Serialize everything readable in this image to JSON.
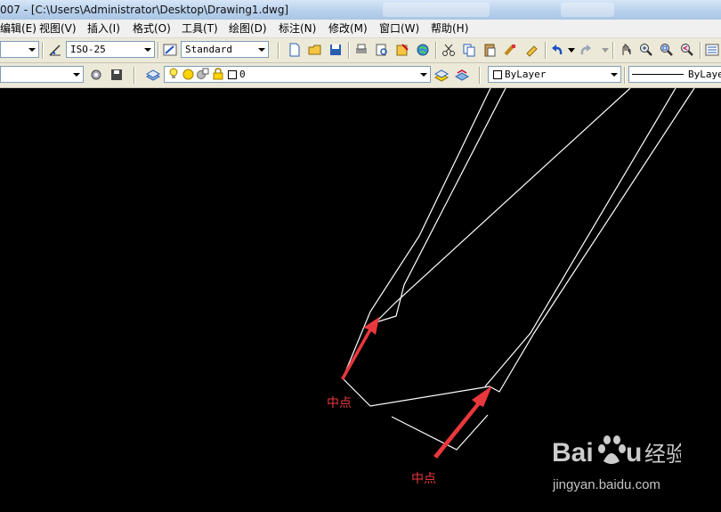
{
  "window": {
    "title": "007 - [C:\\Users\\Administrator\\Desktop\\Drawing1.dwg]"
  },
  "menubar": {
    "items": [
      "编辑(E)",
      "视图(V)",
      "插入(I)",
      "格式(O)",
      "工具(T)",
      "绘图(D)",
      "标注(N)",
      "修改(M)",
      "窗口(W)",
      "帮助(H)"
    ]
  },
  "toolbar1": {
    "dimstyle": "ISO-25",
    "textstyle": "Standard"
  },
  "toolbar2": {
    "layer_name": "0",
    "color": "ByLayer",
    "linetype": "ByLayer"
  },
  "annotations": {
    "midpoint_label_1": "中点",
    "midpoint_label_2": "中点"
  },
  "watermark": {
    "url": "jingyan.baidu.com"
  },
  "colors": {
    "canvas_bg": "#000000",
    "linework": "#ffffff",
    "arrow": "#e8383d",
    "toolbar_bg": "#ece9d8"
  }
}
